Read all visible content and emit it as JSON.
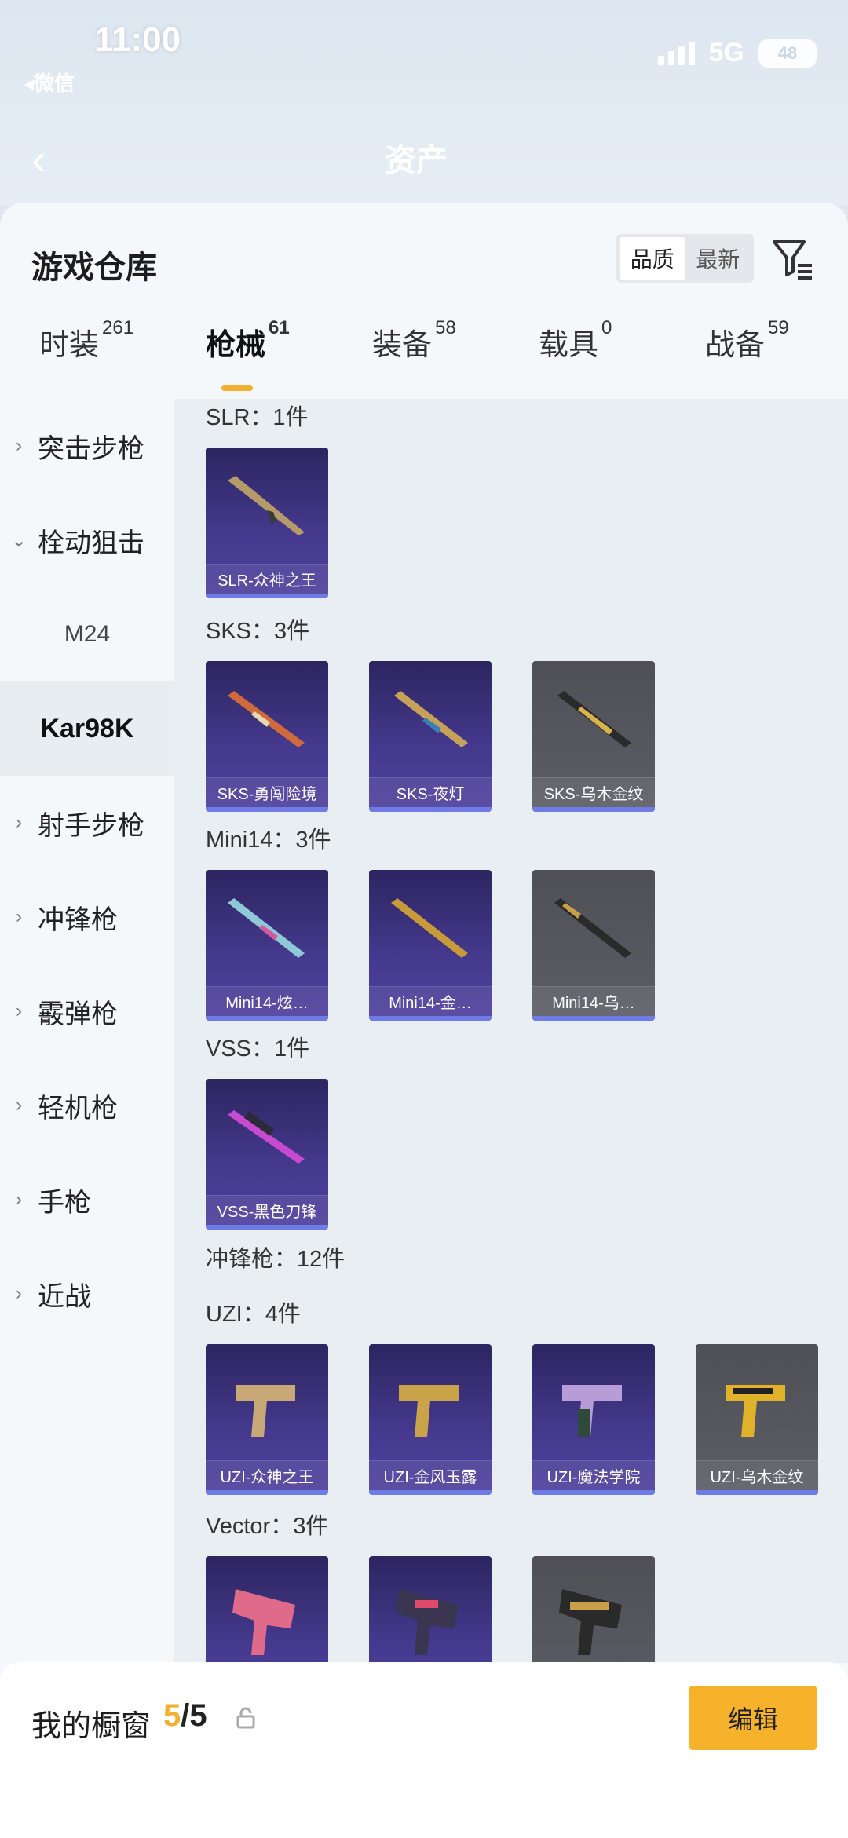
{
  "status_bar": {
    "time": "11:00",
    "network": "5G",
    "battery": "48",
    "back_app": "◂微信"
  },
  "nav": {
    "title": "资产"
  },
  "panel": {
    "title": "游戏仓库",
    "sort_options": [
      "品质",
      "最新"
    ],
    "tabs": [
      {
        "label": "时装",
        "count": "261"
      },
      {
        "label": "枪械",
        "count": "61"
      },
      {
        "label": "装备",
        "count": "58"
      },
      {
        "label": "载具",
        "count": "0"
      },
      {
        "label": "战备",
        "count": "59"
      }
    ]
  },
  "sidebar": {
    "items": [
      {
        "label": "突击步枪"
      },
      {
        "label": "栓动狙击"
      },
      {
        "label": "M24"
      },
      {
        "label": "Kar98K"
      },
      {
        "label": "射手步枪"
      },
      {
        "label": "冲锋枪"
      },
      {
        "label": "霰弹枪"
      },
      {
        "label": "轻机枪"
      },
      {
        "label": "手枪"
      },
      {
        "label": "近战"
      }
    ]
  },
  "content": {
    "sections": [
      {
        "title": "SLR：1件",
        "items": [
          "SLR-众神之王"
        ]
      },
      {
        "title": "SKS：3件",
        "items": [
          "SKS-勇闯险境",
          "SKS-夜灯",
          "SKS-乌木金纹"
        ]
      },
      {
        "title": "Mini14：3件",
        "items": [
          "Mini14-炫…",
          "Mini14-金…",
          "Mini14-乌…"
        ]
      },
      {
        "title": "VSS：1件",
        "items": [
          "VSS-黑色刀锋"
        ]
      },
      {
        "title": "冲锋枪：12件",
        "items": []
      },
      {
        "title": "UZI：4件",
        "items": [
          "UZI-众神之王",
          "UZI-金风玉露",
          "UZI-魔法学院",
          "UZI-乌木金纹"
        ]
      },
      {
        "title": "Vector：3件",
        "items": [
          "",
          "",
          ""
        ]
      }
    ]
  },
  "bottom": {
    "label": "我的橱窗",
    "count_current": "5",
    "count_total": "/5",
    "edit_label": "编辑"
  },
  "colors": {
    "accent": "#f5b22a",
    "card_purple": "#463a8f",
    "card_gray": "#5d5d66"
  }
}
